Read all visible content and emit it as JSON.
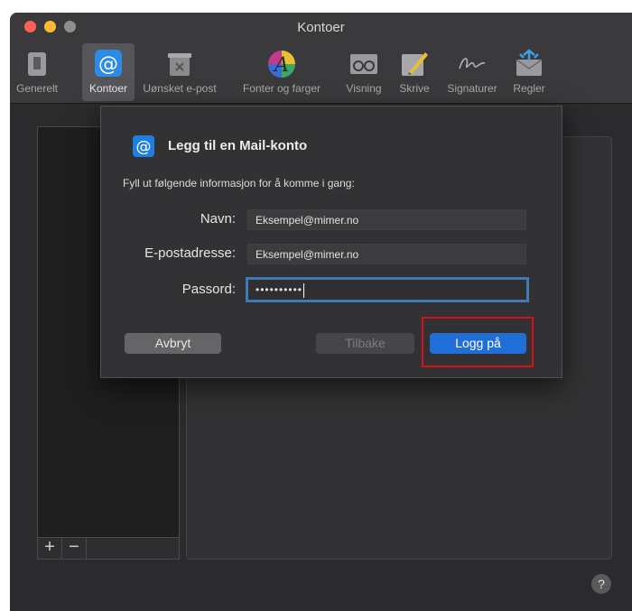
{
  "window": {
    "title": "Kontoer",
    "traffic_colors": {
      "close": "#fe5f57",
      "minimize": "#febc2e",
      "zoom": "#8e8e8e"
    }
  },
  "toolbar": {
    "items": [
      {
        "label": "Generelt",
        "icon": "switch-icon"
      },
      {
        "label": "Kontoer",
        "icon": "at-icon",
        "active": true
      },
      {
        "label": "Uønsket e-post",
        "icon": "junk-icon"
      },
      {
        "label": "Fonter og farger",
        "icon": "font-icon"
      },
      {
        "label": "Visning",
        "icon": "glasses-icon"
      },
      {
        "label": "Skrive",
        "icon": "pencil-icon"
      },
      {
        "label": "Signaturer",
        "icon": "signature-icon"
      },
      {
        "label": "Regler",
        "icon": "rules-icon"
      }
    ]
  },
  "accounts_list": {
    "add": "+",
    "remove": "−"
  },
  "help": "?",
  "dialog": {
    "title": "Legg til en Mail-konto",
    "subtitle": "Fyll ut følgende informasjon for å komme i gang:",
    "name_label": "Navn:",
    "name_value": "Eksempel@mimer.no",
    "email_label": "E-postadresse:",
    "email_value": "Eksempel@mimer.no",
    "password_label": "Passord:",
    "password_value": "••••••••••",
    "cancel": "Avbryt",
    "back": "Tilbake",
    "login": "Logg på",
    "accent": "#1f6fd6",
    "highlight_color": "#d9101a"
  }
}
